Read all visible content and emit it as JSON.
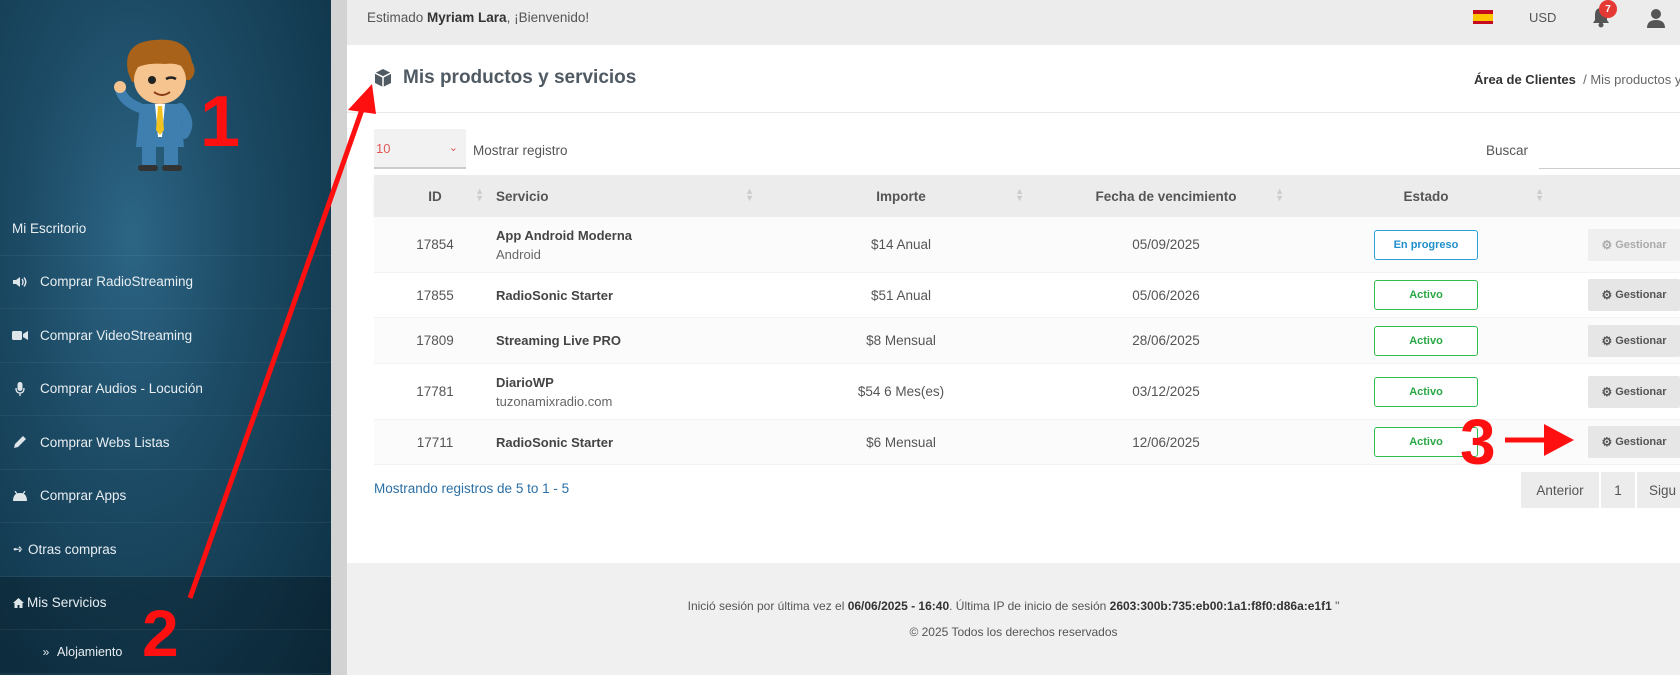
{
  "topbar": {
    "greeting_prefix": "Estimado ",
    "user_name": "Myriam Lara",
    "greeting_suffix": ", ¡Bienvenido!",
    "currency": "USD",
    "notifications_count": "7"
  },
  "sidebar": {
    "items": [
      {
        "label": "Mi Escritorio",
        "icon": "none"
      },
      {
        "label": "Comprar RadioStreaming",
        "icon": "volume-icon"
      },
      {
        "label": "Comprar VideoStreaming",
        "icon": "video-camera-icon"
      },
      {
        "label": "Comprar Audios - Locución",
        "icon": "microphone-icon"
      },
      {
        "label": "Comprar Webs Listas",
        "icon": "pencil-icon"
      },
      {
        "label": "Comprar Apps",
        "icon": "android-icon"
      },
      {
        "label": "Otras compras",
        "icon": "arrow-right-icon"
      },
      {
        "label": "Mis Servicios",
        "icon": "home-icon"
      },
      {
        "label": "Alojamiento",
        "icon": "double-chevron-icon"
      }
    ]
  },
  "page": {
    "title": "Mis productos y servicios",
    "breadcrumb_home": "Área de Clientes",
    "breadcrumb_current": "/ Mis productos y"
  },
  "table_controls": {
    "length_value": "10",
    "length_label": "Mostrar registro",
    "search_label": "Buscar"
  },
  "table": {
    "headers": [
      "ID",
      "Servicio",
      "Importe",
      "Fecha de vencimiento",
      "Estado"
    ],
    "rows": [
      {
        "id": "17854",
        "service": "App Android Moderna",
        "sub": "Android",
        "amount": "$14 Anual",
        "due": "05/09/2025",
        "status": "En progreso",
        "action": "Gestionar"
      },
      {
        "id": "17855",
        "service": "RadioSonic Starter",
        "sub": "",
        "amount": "$51 Anual",
        "due": "05/06/2026",
        "status": "Activo",
        "action": "Gestionar"
      },
      {
        "id": "17809",
        "service": "Streaming Live PRO",
        "sub": "",
        "amount": "$8 Mensual",
        "due": "28/06/2025",
        "status": "Activo",
        "action": "Gestionar"
      },
      {
        "id": "17781",
        "service": "DiarioWP",
        "sub": "tuzonamixradio.com",
        "amount": "$54 6 Mes(es)",
        "due": "03/12/2025",
        "status": "Activo",
        "action": "Gestionar"
      },
      {
        "id": "17711",
        "service": "RadioSonic Starter",
        "sub": "",
        "amount": "$6 Mensual",
        "due": "12/06/2025",
        "status": "Activo",
        "action": "Gestionar"
      }
    ],
    "info": "Mostrando registros de 5 to 1 - 5",
    "pager": {
      "prev": "Anterior",
      "page": "1",
      "next": "Sigu"
    }
  },
  "footer": {
    "last_login_prefix": "Inició sesión por última vez el ",
    "last_login_date": "06/06/2025 - 16:40",
    "ip_prefix": ". Última IP de inicio de sesión ",
    "ip": "2603:300b:735:eb00:1a1:f8f0:d86a:e1f1",
    "ip_suffix": " \"",
    "copyright": "© 2025 Todos los derechos reservados"
  },
  "annotations": {
    "n1": "1",
    "n2": "2",
    "n3": "3"
  },
  "colors": {
    "sidebar": "#1c4a64",
    "active_status": "#2ebd4e",
    "progress_status": "#2a9fd8",
    "annotation": "#ff1010",
    "badge": "#e53935"
  }
}
